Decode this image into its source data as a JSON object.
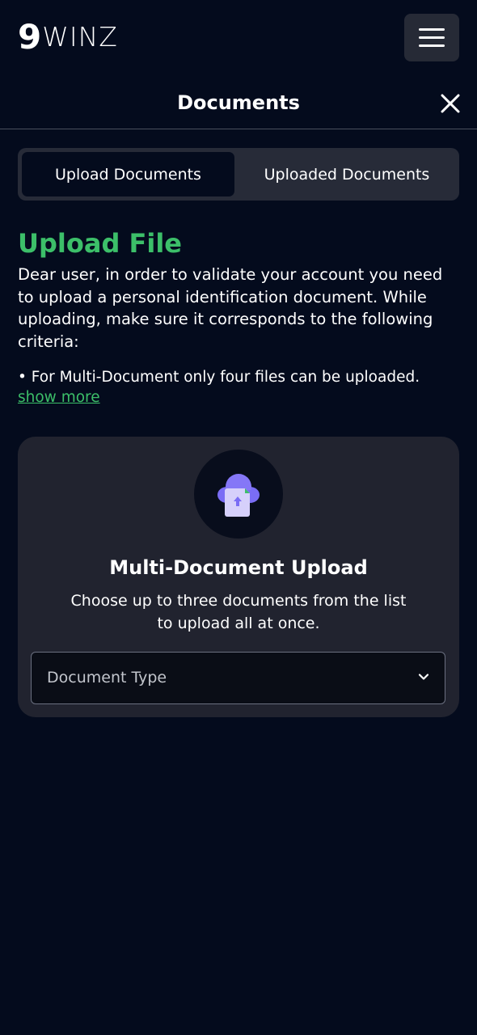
{
  "brand": {
    "logo_mark": "9",
    "logo_text": "WINZ"
  },
  "header": {
    "title": "Documents"
  },
  "tabs": [
    {
      "label": "Upload Documents",
      "active": true
    },
    {
      "label": "Uploaded Documents",
      "active": false
    }
  ],
  "upload": {
    "title": "Upload File",
    "description": "Dear user, in order to validate your account you need to upload a personal identification document. While uploading, make sure it corresponds to the following criteria:",
    "criteria": "• For Multi-Document only four files can be uploaded.",
    "show_more": "show more"
  },
  "card": {
    "icon": "cloud-upload-document-icon",
    "title": "Multi-Document Upload",
    "description": "Choose up to three documents from the list to upload all at once.",
    "select_placeholder": "Document Type"
  },
  "colors": {
    "background": "#040b1d",
    "accent_green": "#3cbf69",
    "card": "#21232f",
    "tab_bar": "#272b38"
  }
}
